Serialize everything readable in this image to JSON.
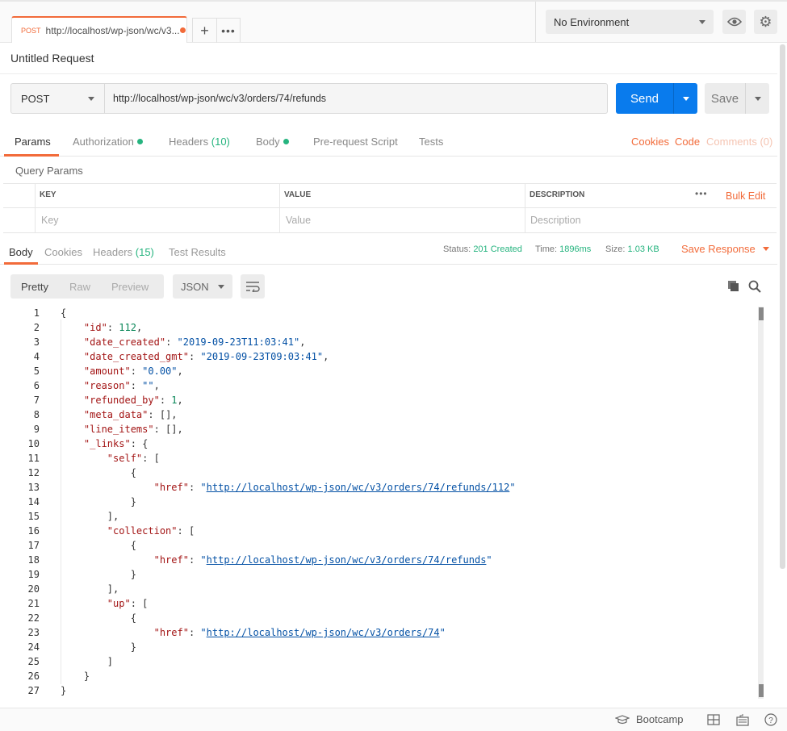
{
  "tab": {
    "method": "POST",
    "url_short": "http://localhost/wp-json/wc/v3..."
  },
  "environment": {
    "selected": "No Environment"
  },
  "request": {
    "title": "Untitled Request",
    "method": "POST",
    "url": "http://localhost/wp-json/wc/v3/orders/74/refunds",
    "send_label": "Send",
    "save_label": "Save"
  },
  "request_tabs": {
    "params": "Params",
    "authorization": "Authorization",
    "headers": "Headers",
    "headers_count": "(10)",
    "body": "Body",
    "prerequest": "Pre-request Script",
    "tests": "Tests",
    "cookies": "Cookies",
    "code": "Code",
    "comments": "Comments (0)"
  },
  "query_params": {
    "title": "Query Params",
    "col_key": "KEY",
    "col_value": "VALUE",
    "col_desc": "DESCRIPTION",
    "bulk_edit": "Bulk Edit",
    "ph_key": "Key",
    "ph_value": "Value",
    "ph_desc": "Description"
  },
  "response_tabs": {
    "body": "Body",
    "cookies": "Cookies",
    "headers": "Headers",
    "headers_count": "(15)",
    "test_results": "Test Results"
  },
  "response_status": {
    "status_label": "Status:",
    "status_value": "201 Created",
    "time_label": "Time:",
    "time_value": "1896ms",
    "size_label": "Size:",
    "size_value": "1.03 KB",
    "save_response": "Save Response"
  },
  "view": {
    "pretty": "Pretty",
    "raw": "Raw",
    "preview": "Preview",
    "format": "JSON"
  },
  "code_lines": [
    "{",
    "    \"id\": 112,",
    "    \"date_created\": \"2019-09-23T11:03:41\",",
    "    \"date_created_gmt\": \"2019-09-23T09:03:41\",",
    "    \"amount\": \"0.00\",",
    "    \"reason\": \"\",",
    "    \"refunded_by\": 1,",
    "    \"meta_data\": [],",
    "    \"line_items\": [],",
    "    \"_links\": {",
    "        \"self\": [",
    "            {",
    "                \"href\": \"http://localhost/wp-json/wc/v3/orders/74/refunds/112\"",
    "            }",
    "        ],",
    "        \"collection\": [",
    "            {",
    "                \"href\": \"http://localhost/wp-json/wc/v3/orders/74/refunds\"",
    "            }",
    "        ],",
    "        \"up\": [",
    "            {",
    "                \"href\": \"http://localhost/wp-json/wc/v3/orders/74\"",
    "            }",
    "        ]",
    "    }",
    "}"
  ],
  "footer": {
    "bootcamp": "Bootcamp"
  }
}
